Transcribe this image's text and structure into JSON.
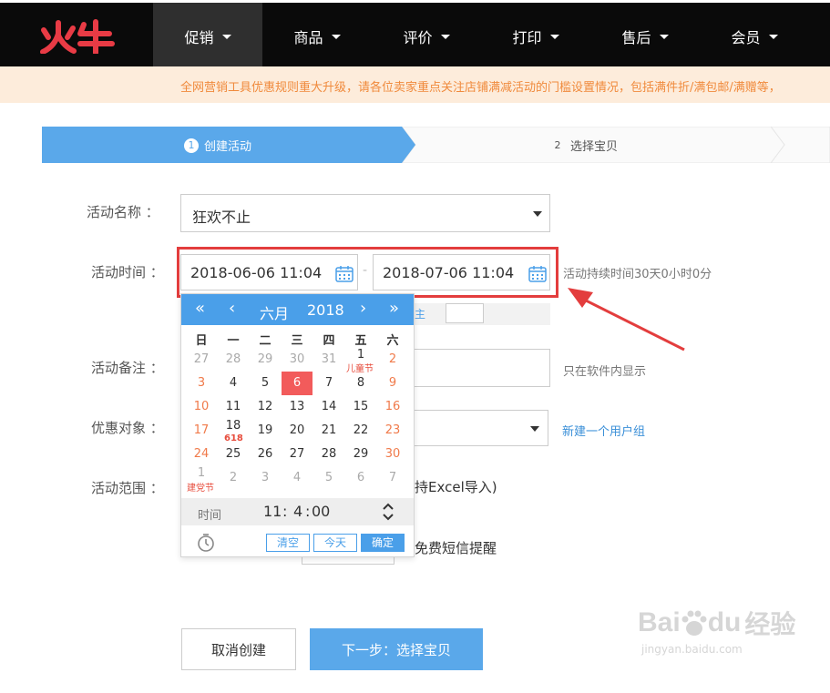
{
  "header": {
    "logo_text": "火牛",
    "nav": [
      "促销",
      "商品",
      "评价",
      "打印",
      "售后",
      "会员"
    ],
    "active_index": 0
  },
  "notice": "全网营销工具优惠规则重大升级，请各位卖家重点关注店铺满减活动的门槛设置情况，包括满件折/满包邮/满赠等，",
  "steps": [
    {
      "num": "1",
      "label": "创建活动"
    },
    {
      "num": "2",
      "label": "选择宝贝"
    }
  ],
  "form": {
    "name_label": "活动名称 ：",
    "name_value": "狂欢不止",
    "time_label": "活动时间 ：",
    "start_time": "2018-06-06 11:04",
    "end_time": "2018-07-06 11:04",
    "time_sep": "-",
    "duration_hint": "活动持续时间30天0小时0分",
    "remark_label": "活动备注 ：",
    "remark_hint": "只在软件内显示",
    "target_label": "优惠对象 ：",
    "new_group_link": "新建一个用户组",
    "scope_label": "活动范围 ：",
    "scope_partial": "持Excel导入)",
    "sms_partial": "免费短信提醒",
    "hidden_partial": "主"
  },
  "calendar": {
    "month": "六月",
    "year": "2018",
    "prev_year": "«",
    "prev_month": "‹",
    "next_month": "›",
    "next_year": "»",
    "weekdays": [
      "日",
      "一",
      "二",
      "三",
      "四",
      "五",
      "六"
    ],
    "weeks": [
      [
        "27",
        "28",
        "29",
        "30",
        "31",
        "1",
        "2"
      ],
      [
        "3",
        "4",
        "5",
        "6",
        "7",
        "8",
        "9"
      ],
      [
        "10",
        "11",
        "12",
        "13",
        "14",
        "15",
        "16"
      ],
      [
        "17",
        "18",
        "19",
        "20",
        "21",
        "22",
        "23"
      ],
      [
        "24",
        "25",
        "26",
        "27",
        "28",
        "29",
        "30"
      ],
      [
        "1",
        "2",
        "3",
        "4",
        "5",
        "6",
        "7"
      ]
    ],
    "holidays": {
      "children_day": "儿童节",
      "sale_618": "618",
      "party_day": "建党节"
    },
    "selected_day": "6",
    "time_label": "时间",
    "time_h": "11",
    "time_m": "4",
    "time_s": "00",
    "clear_label": "清空",
    "today_label": "今天",
    "confirm_label": "确定",
    "colors": {
      "header": "#4a9fe9",
      "selected": "#f25b5b",
      "weekend": "#f07a4a",
      "other_month": "#aaaaaa"
    }
  },
  "buttons": {
    "cancel": "取消创建",
    "next": "下一步：选择宝贝"
  },
  "watermark": {
    "brand": "Bai",
    "brand2": "du",
    "cn": "经验",
    "url": "jingyan.baidu.com"
  }
}
